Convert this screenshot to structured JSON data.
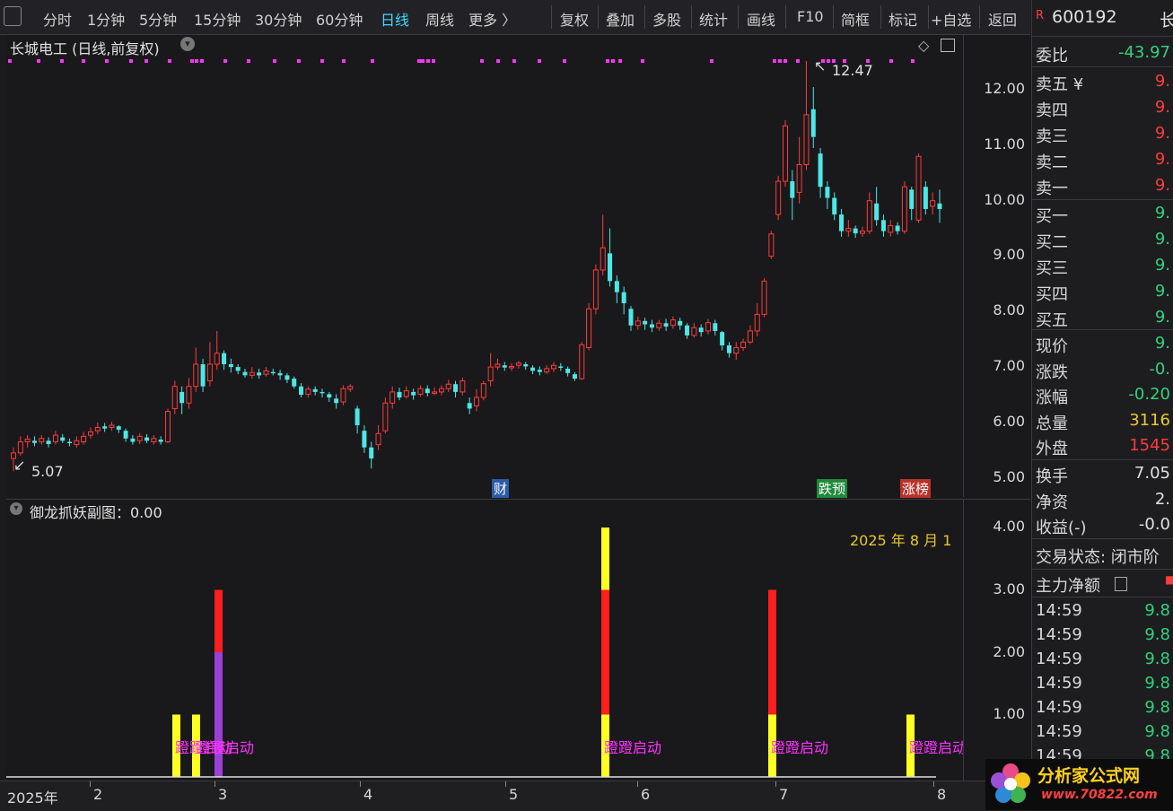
{
  "toolbar": {
    "items": [
      "分时",
      "1分钟",
      "5分钟",
      "15分钟",
      "30分钟",
      "60分钟",
      "日线",
      "周线",
      "更多 〉",
      "复权",
      "叠加",
      "多股",
      "统计",
      "画线",
      "F10",
      "简框",
      "标记",
      "+自选",
      "返回"
    ],
    "active": "日线"
  },
  "main_chart": {
    "title": "长城电工 (日线,前复权)",
    "high_label": "12.47",
    "low_label": "5.07",
    "yticks": [
      "12.00",
      "11.00",
      "10.00",
      "9.00",
      "8.00",
      "7.00",
      "6.00",
      "5.00"
    ],
    "tags": [
      {
        "text": "财",
        "color": "#2a5aa8"
      },
      {
        "text": "跌预",
        "color": "#1f8a3a"
      },
      {
        "text": "涨榜",
        "color": "#b8322a"
      }
    ]
  },
  "sub_chart": {
    "title": "御龙抓妖副图：0.00",
    "date_text": "2025 年 8 月 1",
    "yticks": [
      "4.00",
      "3.00",
      "2.00",
      "1.00"
    ],
    "signal_label": "蹬蹬启动"
  },
  "xaxis": {
    "labels": [
      "2025年",
      "2",
      "3",
      "4",
      "5",
      "6",
      "7",
      "8"
    ]
  },
  "panel": {
    "code": "600192",
    "code_suffix": "长",
    "weibi_label": "委比",
    "weibi_value": "-43.97",
    "sells": [
      {
        "label": "卖五 ¥",
        "value": "9."
      },
      {
        "label": "卖四",
        "value": "9."
      },
      {
        "label": "卖三",
        "value": "9."
      },
      {
        "label": "卖二",
        "value": "9."
      },
      {
        "label": "卖一",
        "value": "9."
      }
    ],
    "buys": [
      {
        "label": "买一",
        "value": "9."
      },
      {
        "label": "买二",
        "value": "9."
      },
      {
        "label": "买三",
        "value": "9."
      },
      {
        "label": "买四",
        "value": "9."
      },
      {
        "label": "买五",
        "value": "9."
      }
    ],
    "quotes": [
      {
        "label": "现价",
        "value": "9.",
        "color": "#33d17a"
      },
      {
        "label": "涨跌",
        "value": "-0.",
        "color": "#33d17a"
      },
      {
        "label": "涨幅",
        "value": "-0.20",
        "color": "#33d17a"
      },
      {
        "label": "总量",
        "value": "3116",
        "color": "#e8c82e"
      },
      {
        "label": "外盘",
        "value": "1545",
        "color": "#ff3b3b"
      }
    ],
    "stats": [
      {
        "label": "换手",
        "value": "7.05"
      },
      {
        "label": "净资",
        "value": "2."
      },
      {
        "label": "收益(-)",
        "value": "-0.0"
      }
    ],
    "trade_status": "交易状态: 闭市阶",
    "main_force": "主力净额",
    "ticks": [
      {
        "time": "14:59",
        "value": "9.8"
      },
      {
        "time": "14:59",
        "value": "9.8"
      },
      {
        "time": "14:59",
        "value": "9.8"
      },
      {
        "time": "14:59",
        "value": "9.8"
      },
      {
        "time": "14:59",
        "value": "9.8"
      },
      {
        "time": "14:59",
        "value": "9.8"
      },
      {
        "time": "14:59",
        "value": "9.8"
      }
    ]
  },
  "watermark": {
    "text": "分析家公式网",
    "url": "www.70822.com"
  },
  "colors": {
    "up": "#ff3b3b",
    "down": "#4fe6e6",
    "signal": "#ff33ff",
    "bar_yellow": "#ffff22",
    "bar_red": "#ff1e1e",
    "bar_purple": "#9b3fd6"
  }
}
